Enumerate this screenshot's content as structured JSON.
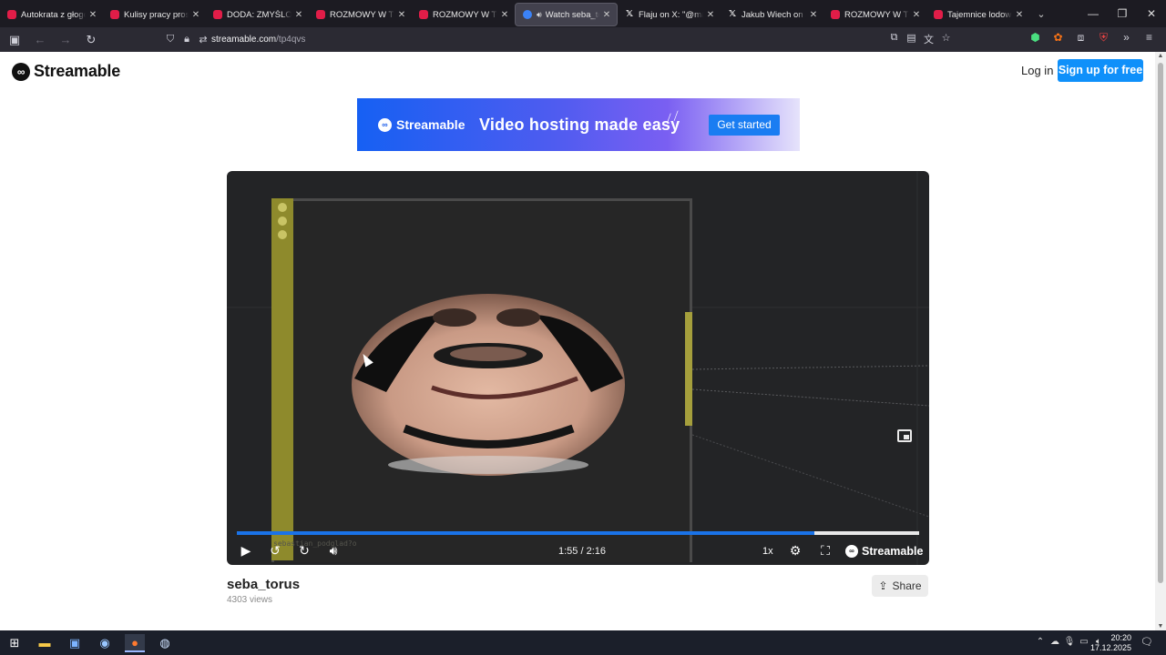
{
  "browser": {
    "tabs": [
      {
        "title": "Autokrata z głogowski",
        "icon": "youtube-icon",
        "active": false
      },
      {
        "title": "Kulisy pracy prostytut",
        "icon": "youtube-icon",
        "active": false
      },
      {
        "title": "DODA: ZMYŚLONE Z",
        "icon": "youtube-icon",
        "active": false
      },
      {
        "title": "ROZMOWY W TOKU",
        "icon": "youtube-icon",
        "active": false
      },
      {
        "title": "ROZMOWY W TOKU",
        "icon": "youtube-icon",
        "active": false
      },
      {
        "title": "Watch seba_torus",
        "icon": "streamable-icon",
        "active": true
      },
      {
        "title": "Flaju on X: \"@mamic",
        "icon": "x-icon",
        "active": false
      },
      {
        "title": "Jakub Wiech on X: \"Z",
        "icon": "x-icon",
        "active": false
      },
      {
        "title": "ROZMOWY W TOKU",
        "icon": "youtube-icon",
        "active": false
      },
      {
        "title": "Tajemnice lodowca",
        "icon": "youtube-icon",
        "active": false
      }
    ],
    "url_host": "streamable.com",
    "url_path": "/tp4qvs"
  },
  "header": {
    "brand": "Streamable",
    "login": "Log in",
    "signup": "Sign up for free"
  },
  "banner": {
    "brand": "Streamable",
    "tagline": "Video hosting made easy",
    "cta": "Get started"
  },
  "player": {
    "time": "1:55 / 2:16",
    "progress_fraction": 0.846,
    "speed": "1x",
    "brand": "Streamable",
    "watermark": "sebastian_podglad?o"
  },
  "video": {
    "title": "seba_torus",
    "views": "4303 views",
    "share": "Share"
  },
  "taskbar": {
    "time": "20:20",
    "date": "17.12.2025"
  },
  "colors": {
    "accent": "#0f90fa",
    "progress": "#1a73e8",
    "player_bg": "#232426",
    "tab_bg": "#1c1b22"
  }
}
